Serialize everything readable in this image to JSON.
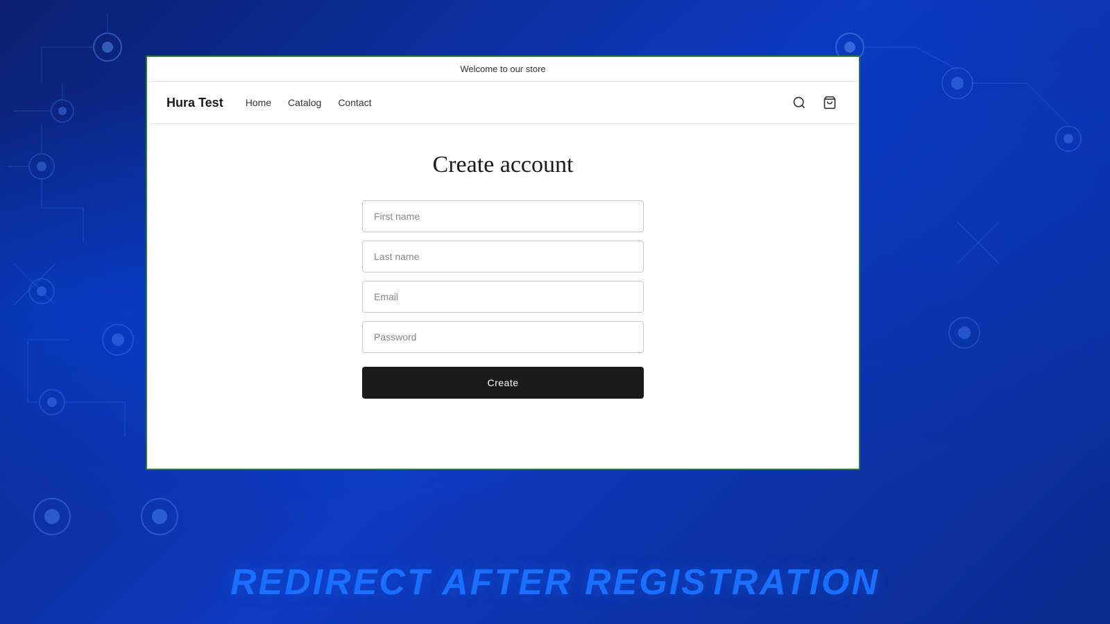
{
  "background": {
    "color": "#0a2a8c"
  },
  "announcement_bar": {
    "text": "Welcome to our store"
  },
  "nav": {
    "logo": "Hura Test",
    "links": [
      {
        "label": "Home",
        "id": "home"
      },
      {
        "label": "Catalog",
        "id": "catalog"
      },
      {
        "label": "Contact",
        "id": "contact"
      }
    ],
    "search_label": "Search",
    "cart_label": "Cart"
  },
  "page": {
    "title": "Create account"
  },
  "form": {
    "first_name_placeholder": "First name",
    "last_name_placeholder": "Last name",
    "email_placeholder": "Email",
    "password_placeholder": "Password",
    "submit_label": "Create"
  },
  "bottom_banner": {
    "text": "REDIRECT AFTER REGISTRATION"
  }
}
